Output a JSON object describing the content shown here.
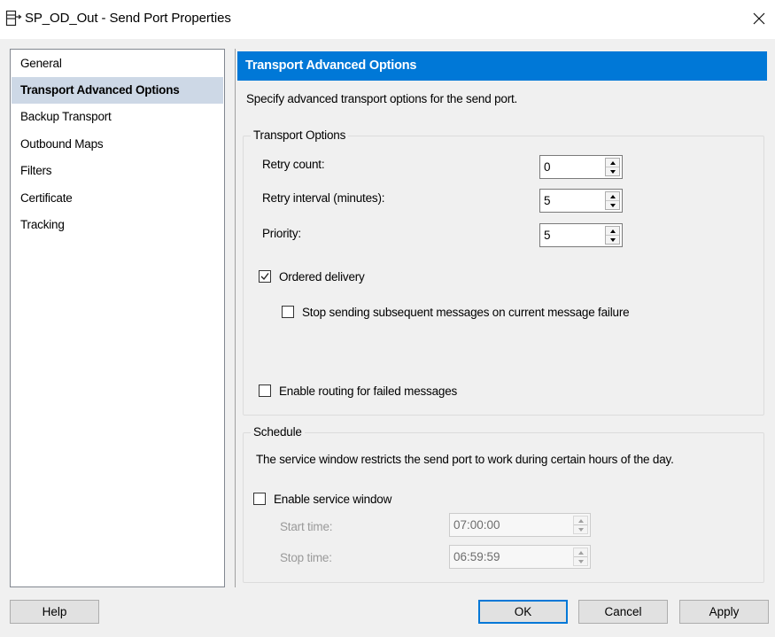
{
  "window": {
    "title": "SP_OD_Out - Send Port Properties",
    "icon": "send-port-icon",
    "close_icon": "close-icon"
  },
  "nav": {
    "items": [
      {
        "label": "General",
        "selected": false
      },
      {
        "label": "Transport Advanced Options",
        "selected": true
      },
      {
        "label": "Backup Transport",
        "selected": false
      },
      {
        "label": "Outbound Maps",
        "selected": false
      },
      {
        "label": "Filters",
        "selected": false
      },
      {
        "label": "Certificate",
        "selected": false
      },
      {
        "label": "Tracking",
        "selected": false
      }
    ]
  },
  "panel": {
    "header": "Transport Advanced Options",
    "description": "Specify advanced transport options for the send port.",
    "header_color": "#0078d7",
    "transport_options": {
      "title": "Transport Options",
      "retry_count": {
        "label": "Retry count:",
        "value": "0"
      },
      "retry_interval": {
        "label": "Retry interval (minutes):",
        "value": "5"
      },
      "priority": {
        "label": "Priority:",
        "value": "5"
      },
      "ordered_delivery": {
        "label": "Ordered delivery",
        "checked": true
      },
      "stop_sending": {
        "label": "Stop sending subsequent messages on current message failure",
        "checked": false
      },
      "enable_routing": {
        "label": "Enable routing for failed messages",
        "checked": false
      }
    },
    "schedule": {
      "title": "Schedule",
      "description": "The service window restricts the send port to work during certain hours of the day.",
      "enable_service_window": {
        "label": "Enable service window",
        "checked": false
      },
      "start_time": {
        "label": "Start time:",
        "value": "07:00:00"
      },
      "stop_time": {
        "label": "Stop time:",
        "value": "06:59:59"
      }
    }
  },
  "buttons": {
    "help": "Help",
    "ok": "OK",
    "cancel": "Cancel",
    "apply": "Apply"
  }
}
